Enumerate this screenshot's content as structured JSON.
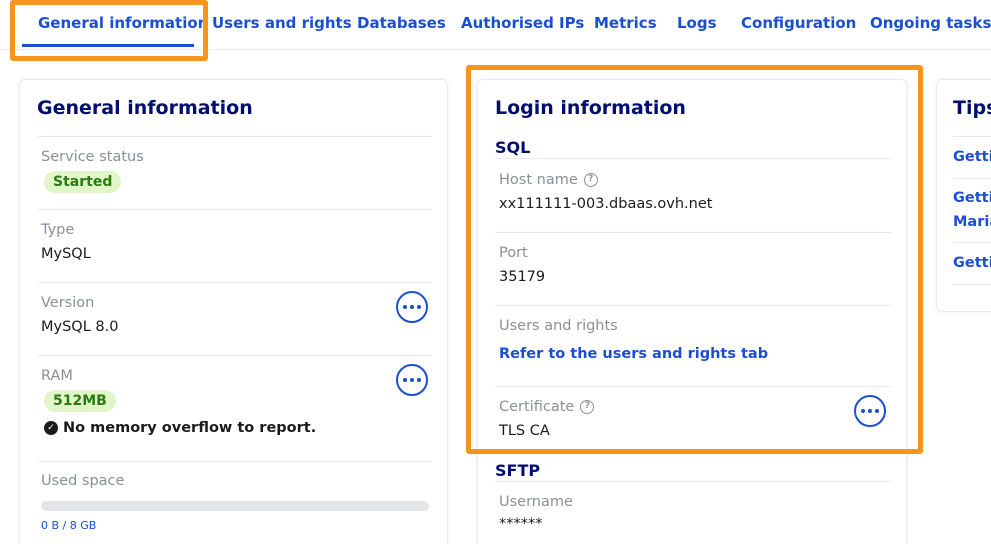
{
  "tabs": [
    {
      "label": "General information"
    },
    {
      "label": "Users and rights"
    },
    {
      "label": "Databases"
    },
    {
      "label": "Authorised IPs"
    },
    {
      "label": "Metrics"
    },
    {
      "label": "Logs"
    },
    {
      "label": "Configuration"
    },
    {
      "label": "Ongoing tasks"
    }
  ],
  "highlight_color": "#f7941d",
  "accent_color": "#1b4fd1",
  "general": {
    "title": "General information",
    "service_status_label": "Service status",
    "service_status_value": "Started",
    "type_label": "Type",
    "type_value": "MySQL",
    "version_label": "Version",
    "version_value": "MySQL 8.0",
    "ram_label": "RAM",
    "ram_value": "512MB",
    "ram_note": "No memory overflow to report.",
    "used_space_label": "Used space",
    "used_space_text": "0 B / 8 GB",
    "used_space_fraction": 0
  },
  "login": {
    "title": "Login information",
    "sql_title": "SQL",
    "host_label": "Host name",
    "host_value": "xx111111-003.dbaas.ovh.net",
    "port_label": "Port",
    "port_value": "35179",
    "users_label": "Users and rights",
    "users_link": "Refer to the users and rights tab",
    "cert_label": "Certificate",
    "cert_value": "TLS CA",
    "sftp_title": "SFTP",
    "username_label": "Username",
    "username_value": "******"
  },
  "tips": {
    "title": "Tips",
    "links": [
      "Gettir",
      "Gettir",
      "Maria",
      "Gettir"
    ]
  }
}
